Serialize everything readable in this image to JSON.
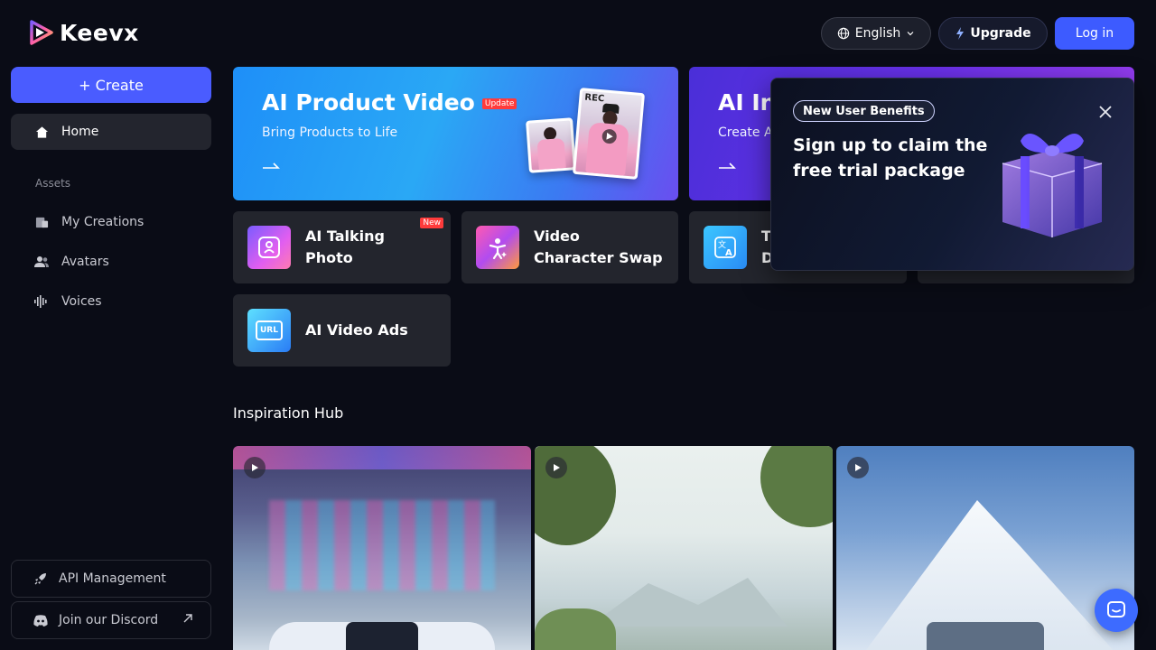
{
  "app": {
    "name": "Keevx"
  },
  "header": {
    "language": "English",
    "upgrade": "Upgrade",
    "login": "Log in"
  },
  "sidebar": {
    "create": "+ Create",
    "home": "Home",
    "section_assets": "Assets",
    "items": [
      {
        "label": "My Creations",
        "icon": "creations-icon"
      },
      {
        "label": "Avatars",
        "icon": "avatars-icon"
      },
      {
        "label": "Voices",
        "icon": "voices-icon"
      }
    ],
    "api": "API Management",
    "discord": "Join our Discord"
  },
  "banners": [
    {
      "title": "AI Product Video",
      "badge": "Update",
      "subtitle": "Bring Products to Life",
      "photo_label": "REC"
    },
    {
      "title": "AI In",
      "subtitle": "Create A"
    }
  ],
  "tools": [
    {
      "label_line1": "AI Talking",
      "label_line2": "Photo",
      "badge": "New"
    },
    {
      "label_line1": "Video",
      "label_line2": "Character Swap"
    },
    {
      "label_line1": "T",
      "label_line2": "D"
    },
    {
      "label_line1": "AI Video Ads"
    }
  ],
  "tool_icon_text": "URL",
  "inspiration": {
    "title": "Inspiration Hub"
  },
  "popup": {
    "badge": "New User Benefits",
    "title": "Sign up to claim the free trial package"
  },
  "colors": {
    "accent": "#4a5cff",
    "background": "#0a0c16",
    "card": "#23252d",
    "badge_red": "#ff3b3b"
  }
}
